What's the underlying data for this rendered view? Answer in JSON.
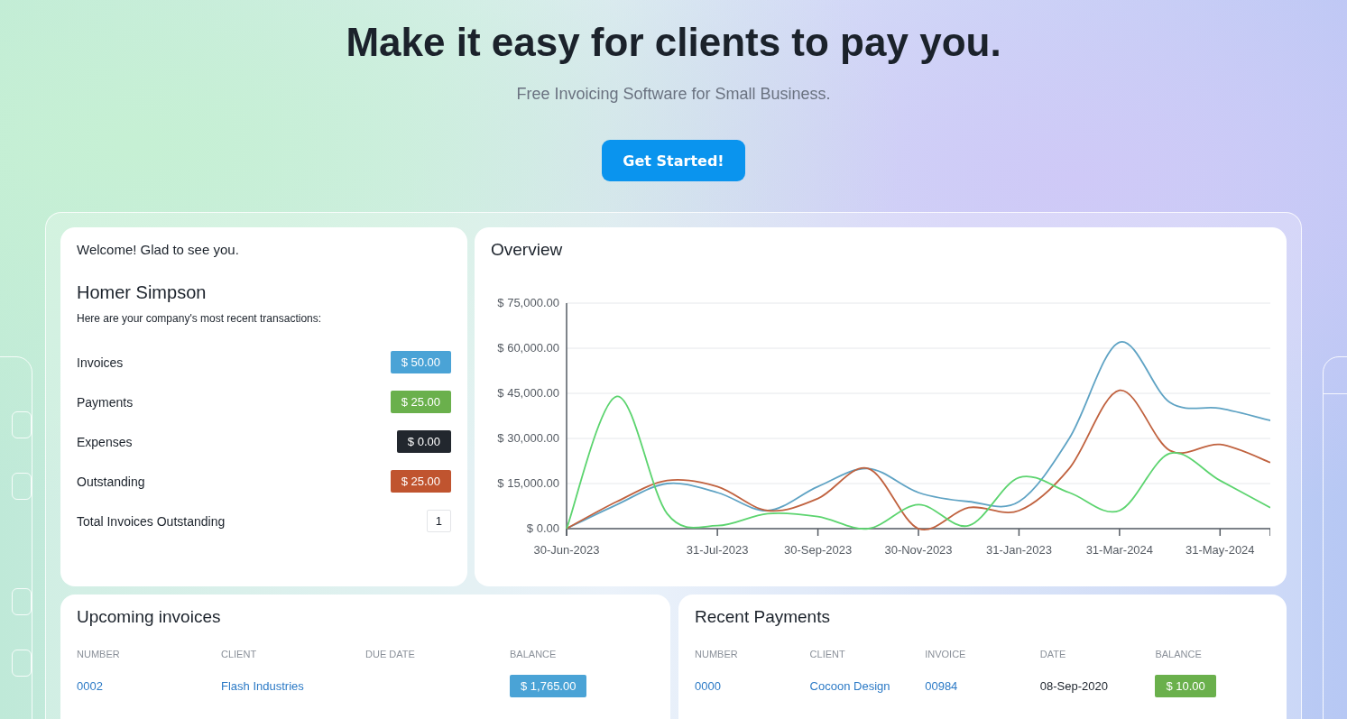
{
  "hero": {
    "title": "Make it easy for clients to pay you.",
    "subtitle": "Free Invoicing Software for Small Business.",
    "button": "Get Started!"
  },
  "welcome": {
    "greeting": "Welcome! Glad to see you.",
    "name": "Homer Simpson",
    "intro": "Here are your company's most recent transactions:",
    "items": [
      {
        "label": "Invoices",
        "value": "$ 50.00",
        "color": "#4aa3d6"
      },
      {
        "label": "Payments",
        "value": "$ 25.00",
        "color": "#6ab04c"
      },
      {
        "label": "Expenses",
        "value": "$ 0.00",
        "color": "#22272e"
      },
      {
        "label": "Outstanding",
        "value": "$ 25.00",
        "color": "#c0542f"
      }
    ],
    "total": {
      "label": "Total Invoices Outstanding",
      "value": "1"
    }
  },
  "overview": {
    "title": "Overview",
    "chart_data": {
      "type": "line",
      "categories": [
        "30-Jun-2023",
        null,
        null,
        "31-Jul-2023",
        null,
        "30-Sep-2023",
        null,
        "30-Nov-2023",
        null,
        "31-Jan-2023",
        null,
        "31-Mar-2024",
        null,
        "31-May-2024",
        null
      ],
      "grid": true,
      "ylim": [
        0,
        75000
      ],
      "yticks": [
        {
          "value": 0,
          "label": "$ 0.00"
        },
        {
          "value": 15000,
          "label": "$ 15,000.00"
        },
        {
          "value": 30000,
          "label": "$ 30,000.00"
        },
        {
          "value": 45000,
          "label": "$ 45,000.00"
        },
        {
          "value": 60000,
          "label": "$ 60,000.00"
        },
        {
          "value": 75000,
          "label": "$ 75,000.00"
        }
      ],
      "series": [
        {
          "color": "#5fa3c4",
          "values": [
            0,
            8000,
            15000,
            12000,
            6000,
            14000,
            20000,
            12000,
            9000,
            9000,
            30000,
            62000,
            42000,
            40000,
            36000
          ]
        },
        {
          "color": "#c0623f",
          "values": [
            0,
            9000,
            16000,
            14000,
            6000,
            10000,
            20000,
            0,
            7000,
            6000,
            20000,
            46000,
            26000,
            28000,
            22000
          ]
        },
        {
          "color": "#5cd46f",
          "values": [
            0,
            44000,
            5000,
            1000,
            5000,
            4000,
            0,
            8000,
            1000,
            17000,
            12000,
            6000,
            25000,
            16000,
            7000
          ]
        }
      ]
    }
  },
  "upcoming": {
    "title": "Upcoming invoices",
    "columns": [
      "NUMBER",
      "CLIENT",
      "DUE DATE",
      "BALANCE"
    ],
    "rows": [
      {
        "number": "0002",
        "client": "Flash Industries",
        "balance": "$ 1,765.00"
      }
    ]
  },
  "payments": {
    "title": "Recent Payments",
    "columns": [
      "NUMBER",
      "CLIENT",
      "INVOICE",
      "DATE",
      "BALANCE"
    ],
    "rows": [
      {
        "number": "0000",
        "client": "Cocoon Design",
        "invoice": "00984",
        "date": "08-Sep-2020",
        "balance": "$ 10.00"
      }
    ]
  }
}
